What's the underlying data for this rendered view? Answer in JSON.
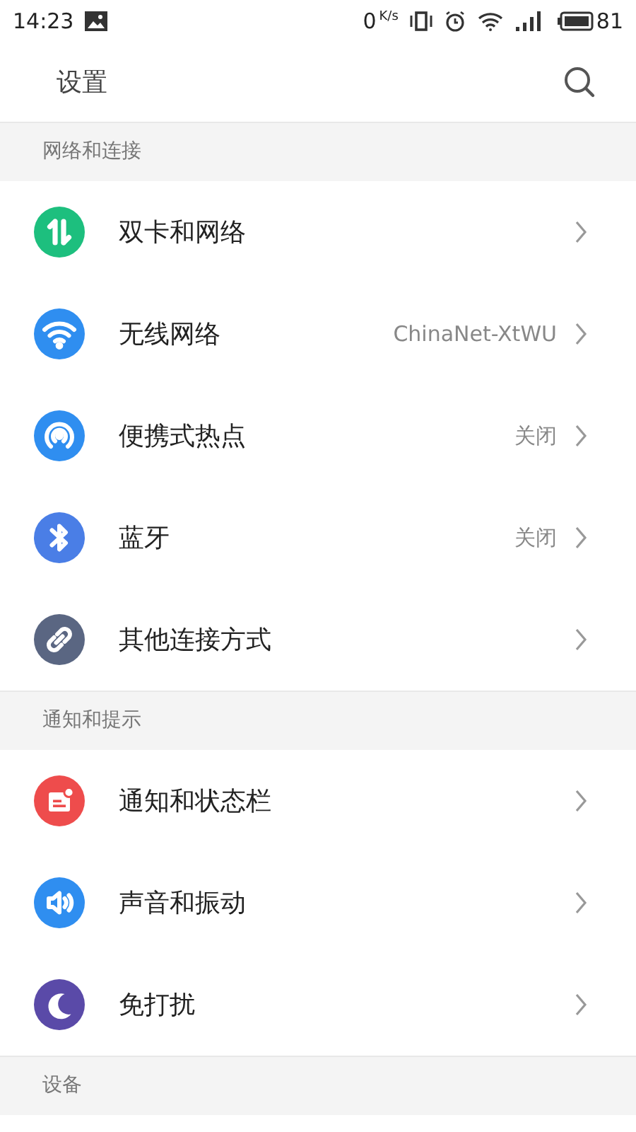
{
  "status_bar": {
    "time": "14:23",
    "net_speed": "0",
    "net_speed_unit": "K/s",
    "battery_percent": "81"
  },
  "header": {
    "title": "设置"
  },
  "sections": [
    {
      "title": "网络和连接",
      "items": [
        {
          "label": "双卡和网络",
          "kind": "dual-sim",
          "color": "#1dbf7e"
        },
        {
          "label": "无线网络",
          "kind": "wifi",
          "color": "#2f8ef0",
          "value": "ChinaNet-XtWU"
        },
        {
          "label": "便携式热点",
          "kind": "hotspot",
          "color": "#2f8ef0",
          "value": "关闭"
        },
        {
          "label": "蓝牙",
          "kind": "bluetooth",
          "color": "#4a7ee6",
          "value": "关闭"
        },
        {
          "label": "其他连接方式",
          "kind": "link",
          "color": "#5a6682"
        }
      ]
    },
    {
      "title": "通知和提示",
      "items": [
        {
          "label": "通知和状态栏",
          "kind": "notification",
          "color": "#ee4c4c"
        },
        {
          "label": "声音和振动",
          "kind": "sound",
          "color": "#2f8ef0"
        },
        {
          "label": "免打扰",
          "kind": "moon",
          "color": "#5a4aa8"
        }
      ]
    },
    {
      "title": "设备"
    }
  ]
}
